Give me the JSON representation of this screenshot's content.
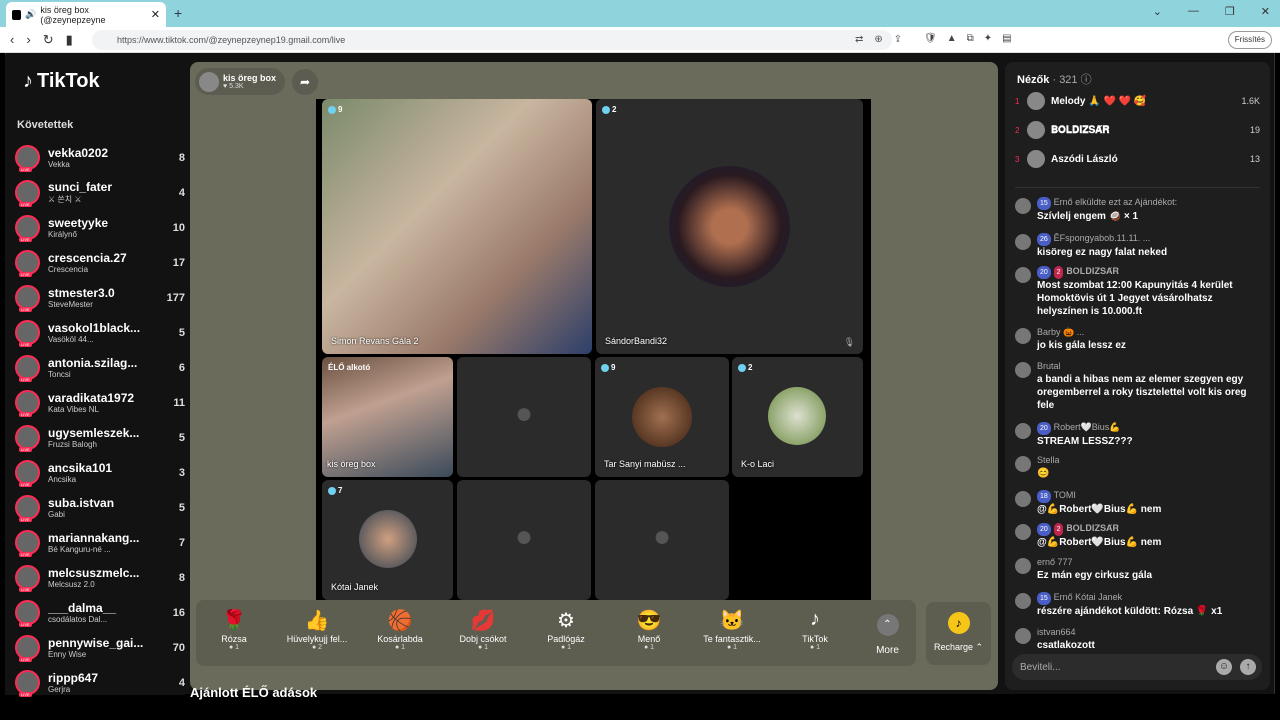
{
  "browser": {
    "tab_title": "kis öreg box (@zeynepzeyne",
    "url": "https://www.tiktok.com/@zeynepzeynep19.gmail.com/live",
    "update_label": "Frissítés"
  },
  "sidebar": {
    "logo": "TikTok",
    "following_title": "Követettek",
    "accounts": [
      {
        "name": "vekka0202",
        "desc": "Vekka",
        "count": "8"
      },
      {
        "name": "sunci_fater",
        "desc": "⚔ 쏜치 ⚔",
        "count": "4"
      },
      {
        "name": "sweetyyke",
        "desc": "Királynő",
        "count": "10"
      },
      {
        "name": "crescencia.27",
        "desc": "Crescencia",
        "count": "17"
      },
      {
        "name": "stmester3.0",
        "desc": "SteveMester",
        "count": "177"
      },
      {
        "name": "vasokol1black...",
        "desc": "Vasököl 44...",
        "count": "5"
      },
      {
        "name": "antonia.szilag...",
        "desc": "Toncsi",
        "count": "6"
      },
      {
        "name": "varadikata1972",
        "desc": "Kata Vibes NL",
        "count": "11"
      },
      {
        "name": "ugysemleszek...",
        "desc": "Fruzsi Balogh",
        "count": "5"
      },
      {
        "name": "ancsika101",
        "desc": "Ancsika",
        "count": "3"
      },
      {
        "name": "suba.istvan",
        "desc": "Gabi",
        "count": "5"
      },
      {
        "name": "mariannakang...",
        "desc": "Bé Kanguru-né ...",
        "count": "7"
      },
      {
        "name": "melcsuszmelc...",
        "desc": "Melcsusz 2.0",
        "count": "8"
      },
      {
        "name": "___dalma__",
        "desc": "csodálatos Dal...",
        "count": "16"
      },
      {
        "name": "pennywise_gai...",
        "desc": "Enny Wise",
        "count": "70"
      },
      {
        "name": "rippp647",
        "desc": "Gerjra",
        "count": "4"
      }
    ]
  },
  "host": {
    "name": "kis öreg box",
    "likes": "5.3K"
  },
  "tiles": [
    {
      "count": "9",
      "name": "Simon Revans Gála 2"
    },
    {
      "count": "2",
      "name": "SándorBandi32"
    },
    {
      "badge": "ÉLŐ alkotó",
      "name": "kis öreg box"
    },
    {
      "count": "9",
      "name": "Tar Sanyi mabüsz ..."
    },
    {
      "count": "2",
      "name": "K-o Laci"
    },
    {
      "count": "7",
      "name": "Kótai Janek"
    }
  ],
  "gifts": [
    {
      "name": "Rózsa",
      "price": "1"
    },
    {
      "name": "Hüvelykujj fel...",
      "price": "2"
    },
    {
      "name": "Kosárlabda",
      "price": "1"
    },
    {
      "name": "Dobj csókot",
      "price": "1"
    },
    {
      "name": "Padlógáz",
      "price": "1"
    },
    {
      "name": "Menő",
      "price": "1"
    },
    {
      "name": "Te fantasztik...",
      "price": "1"
    },
    {
      "name": "TikTok",
      "price": "1"
    }
  ],
  "gift_more": "More",
  "recharge": "Recharge",
  "recommended_title": "Ajánlott ÉLŐ adások",
  "viewers": {
    "title": "Nézők",
    "count": "· 321",
    "top": [
      {
        "rank": "1",
        "name": "Melody 🙏 ❤️ ❤️ 🥰",
        "score": "1.6K"
      },
      {
        "rank": "2",
        "name": "𝐁𝐎𝐋𝐃𝐈𝐙𝐒𝐀́𝐑",
        "score": "19"
      },
      {
        "rank": "3",
        "name": "Aszódi László",
        "score": "13"
      }
    ]
  },
  "chat": [
    {
      "user": "Ernő elküldte ezt az Ajándékot:",
      "text": "Szívlelj engem 🥥 × 1",
      "lv": "15"
    },
    {
      "user": "ĚFspongyabob.11.11. ...",
      "text": "kisöreg ez nagy falat neked",
      "lv": "26"
    },
    {
      "user": "𝐁𝐎𝐋𝐃𝐈𝐙𝐒𝐀́𝐑",
      "text": "Most szombat 12:00 Kapunyitás 4 kerület Homoktövis út 1 Jegyet vásárolhatsz helyszínen is 10.000.ft",
      "lv": "20",
      "sub": "2"
    },
    {
      "user": "Barby 🎃 ...",
      "text": "jo kis gála lessz ez"
    },
    {
      "user": "Brutal",
      "text": "a bandi a hibas nem az elemer szegyen egy oregemberrel a roky tisztelettel volt kis oreg fele"
    },
    {
      "user": "Robert🤍Bius💪",
      "text": "STREAM LESSZ???",
      "lv": "20"
    },
    {
      "user": "Stella",
      "text": "😊"
    },
    {
      "user": "TOMI",
      "text": "@💪Robert🤍Bius💪 nem",
      "lv": "18"
    },
    {
      "user": "𝐁𝐎𝐋𝐃𝐈𝐙𝐒𝐀́𝐑",
      "text": "@💪Robert🤍Bius💪 nem",
      "lv": "20",
      "sub": "2"
    },
    {
      "user": "ernő 777",
      "text": "Ez mán egy cirkusz gála"
    },
    {
      "user": "Ernő Kótai Janek",
      "text": "részére ajándékot küldött: Rózsa 🌹 x1",
      "lv": "15"
    },
    {
      "user": "istvan664",
      "text": "csatlakozott"
    }
  ],
  "input": {
    "placeholder": "Beviteli..."
  }
}
